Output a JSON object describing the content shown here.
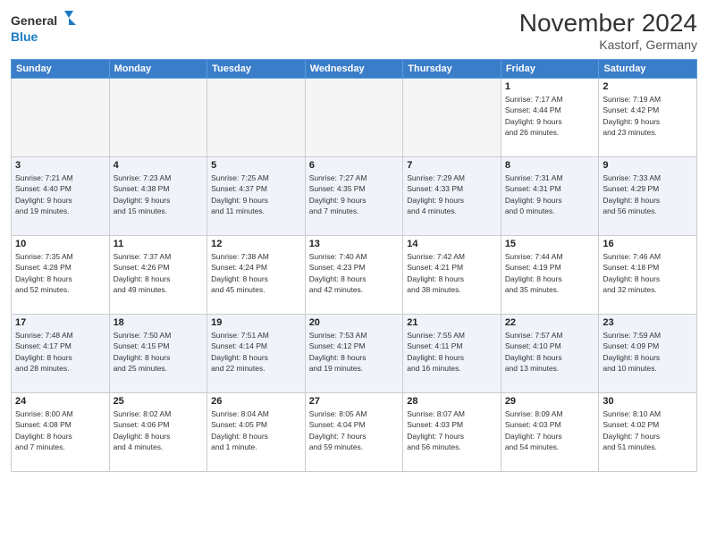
{
  "logo": {
    "line1": "General",
    "line2": "Blue"
  },
  "title": "November 2024",
  "location": "Kastorf, Germany",
  "days_of_week": [
    "Sunday",
    "Monday",
    "Tuesday",
    "Wednesday",
    "Thursday",
    "Friday",
    "Saturday"
  ],
  "weeks": [
    [
      {
        "day": "",
        "info": ""
      },
      {
        "day": "",
        "info": ""
      },
      {
        "day": "",
        "info": ""
      },
      {
        "day": "",
        "info": ""
      },
      {
        "day": "",
        "info": ""
      },
      {
        "day": "1",
        "info": "Sunrise: 7:17 AM\nSunset: 4:44 PM\nDaylight: 9 hours\nand 26 minutes."
      },
      {
        "day": "2",
        "info": "Sunrise: 7:19 AM\nSunset: 4:42 PM\nDaylight: 9 hours\nand 23 minutes."
      }
    ],
    [
      {
        "day": "3",
        "info": "Sunrise: 7:21 AM\nSunset: 4:40 PM\nDaylight: 9 hours\nand 19 minutes."
      },
      {
        "day": "4",
        "info": "Sunrise: 7:23 AM\nSunset: 4:38 PM\nDaylight: 9 hours\nand 15 minutes."
      },
      {
        "day": "5",
        "info": "Sunrise: 7:25 AM\nSunset: 4:37 PM\nDaylight: 9 hours\nand 11 minutes."
      },
      {
        "day": "6",
        "info": "Sunrise: 7:27 AM\nSunset: 4:35 PM\nDaylight: 9 hours\nand 7 minutes."
      },
      {
        "day": "7",
        "info": "Sunrise: 7:29 AM\nSunset: 4:33 PM\nDaylight: 9 hours\nand 4 minutes."
      },
      {
        "day": "8",
        "info": "Sunrise: 7:31 AM\nSunset: 4:31 PM\nDaylight: 9 hours\nand 0 minutes."
      },
      {
        "day": "9",
        "info": "Sunrise: 7:33 AM\nSunset: 4:29 PM\nDaylight: 8 hours\nand 56 minutes."
      }
    ],
    [
      {
        "day": "10",
        "info": "Sunrise: 7:35 AM\nSunset: 4:28 PM\nDaylight: 8 hours\nand 52 minutes."
      },
      {
        "day": "11",
        "info": "Sunrise: 7:37 AM\nSunset: 4:26 PM\nDaylight: 8 hours\nand 49 minutes."
      },
      {
        "day": "12",
        "info": "Sunrise: 7:38 AM\nSunset: 4:24 PM\nDaylight: 8 hours\nand 45 minutes."
      },
      {
        "day": "13",
        "info": "Sunrise: 7:40 AM\nSunset: 4:23 PM\nDaylight: 8 hours\nand 42 minutes."
      },
      {
        "day": "14",
        "info": "Sunrise: 7:42 AM\nSunset: 4:21 PM\nDaylight: 8 hours\nand 38 minutes."
      },
      {
        "day": "15",
        "info": "Sunrise: 7:44 AM\nSunset: 4:19 PM\nDaylight: 8 hours\nand 35 minutes."
      },
      {
        "day": "16",
        "info": "Sunrise: 7:46 AM\nSunset: 4:18 PM\nDaylight: 8 hours\nand 32 minutes."
      }
    ],
    [
      {
        "day": "17",
        "info": "Sunrise: 7:48 AM\nSunset: 4:17 PM\nDaylight: 8 hours\nand 28 minutes."
      },
      {
        "day": "18",
        "info": "Sunrise: 7:50 AM\nSunset: 4:15 PM\nDaylight: 8 hours\nand 25 minutes."
      },
      {
        "day": "19",
        "info": "Sunrise: 7:51 AM\nSunset: 4:14 PM\nDaylight: 8 hours\nand 22 minutes."
      },
      {
        "day": "20",
        "info": "Sunrise: 7:53 AM\nSunset: 4:12 PM\nDaylight: 8 hours\nand 19 minutes."
      },
      {
        "day": "21",
        "info": "Sunrise: 7:55 AM\nSunset: 4:11 PM\nDaylight: 8 hours\nand 16 minutes."
      },
      {
        "day": "22",
        "info": "Sunrise: 7:57 AM\nSunset: 4:10 PM\nDaylight: 8 hours\nand 13 minutes."
      },
      {
        "day": "23",
        "info": "Sunrise: 7:59 AM\nSunset: 4:09 PM\nDaylight: 8 hours\nand 10 minutes."
      }
    ],
    [
      {
        "day": "24",
        "info": "Sunrise: 8:00 AM\nSunset: 4:08 PM\nDaylight: 8 hours\nand 7 minutes."
      },
      {
        "day": "25",
        "info": "Sunrise: 8:02 AM\nSunset: 4:06 PM\nDaylight: 8 hours\nand 4 minutes."
      },
      {
        "day": "26",
        "info": "Sunrise: 8:04 AM\nSunset: 4:05 PM\nDaylight: 8 hours\nand 1 minute."
      },
      {
        "day": "27",
        "info": "Sunrise: 8:05 AM\nSunset: 4:04 PM\nDaylight: 7 hours\nand 59 minutes."
      },
      {
        "day": "28",
        "info": "Sunrise: 8:07 AM\nSunset: 4:03 PM\nDaylight: 7 hours\nand 56 minutes."
      },
      {
        "day": "29",
        "info": "Sunrise: 8:09 AM\nSunset: 4:03 PM\nDaylight: 7 hours\nand 54 minutes."
      },
      {
        "day": "30",
        "info": "Sunrise: 8:10 AM\nSunset: 4:02 PM\nDaylight: 7 hours\nand 51 minutes."
      }
    ]
  ]
}
